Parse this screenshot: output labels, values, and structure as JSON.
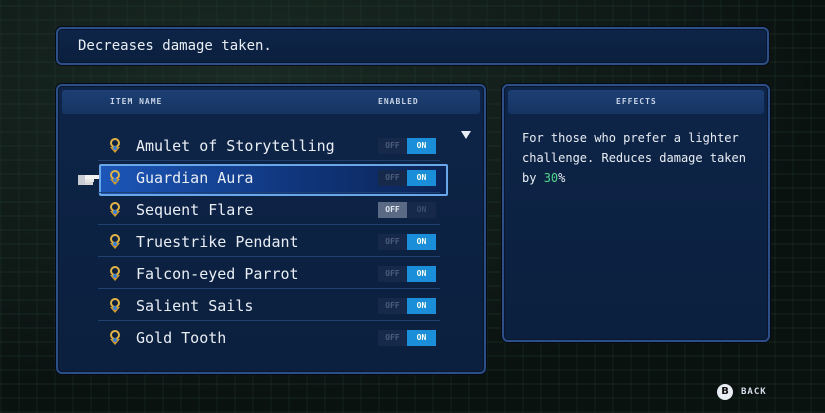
{
  "description": "Decreases damage taken.",
  "items_panel": {
    "header_name": "ITEM NAME",
    "header_enabled": "ENABLED",
    "toggle_off": "OFF",
    "toggle_on": "ON",
    "items": [
      {
        "name": "Amulet of Storytelling",
        "enabled": true
      },
      {
        "name": "Guardian Aura",
        "enabled": true,
        "selected": true
      },
      {
        "name": "Sequent Flare",
        "enabled": false
      },
      {
        "name": "Truestrike Pendant",
        "enabled": true
      },
      {
        "name": "Falcon-eyed Parrot",
        "enabled": true
      },
      {
        "name": "Salient Sails",
        "enabled": true
      },
      {
        "name": "Gold Tooth",
        "enabled": true
      }
    ]
  },
  "effects_panel": {
    "header": "EFFECTS",
    "text_before": "For those who prefer a lighter challenge. Reduces damage taken by ",
    "highlight": "30",
    "text_after": "%",
    "highlight_color": "#4fd68c"
  },
  "back": {
    "button": "B",
    "label": "BACK"
  },
  "icons": {
    "item": "amulet-icon",
    "cursor": "pointing-hand-icon",
    "scroll": "scroll-down-arrow-icon"
  }
}
